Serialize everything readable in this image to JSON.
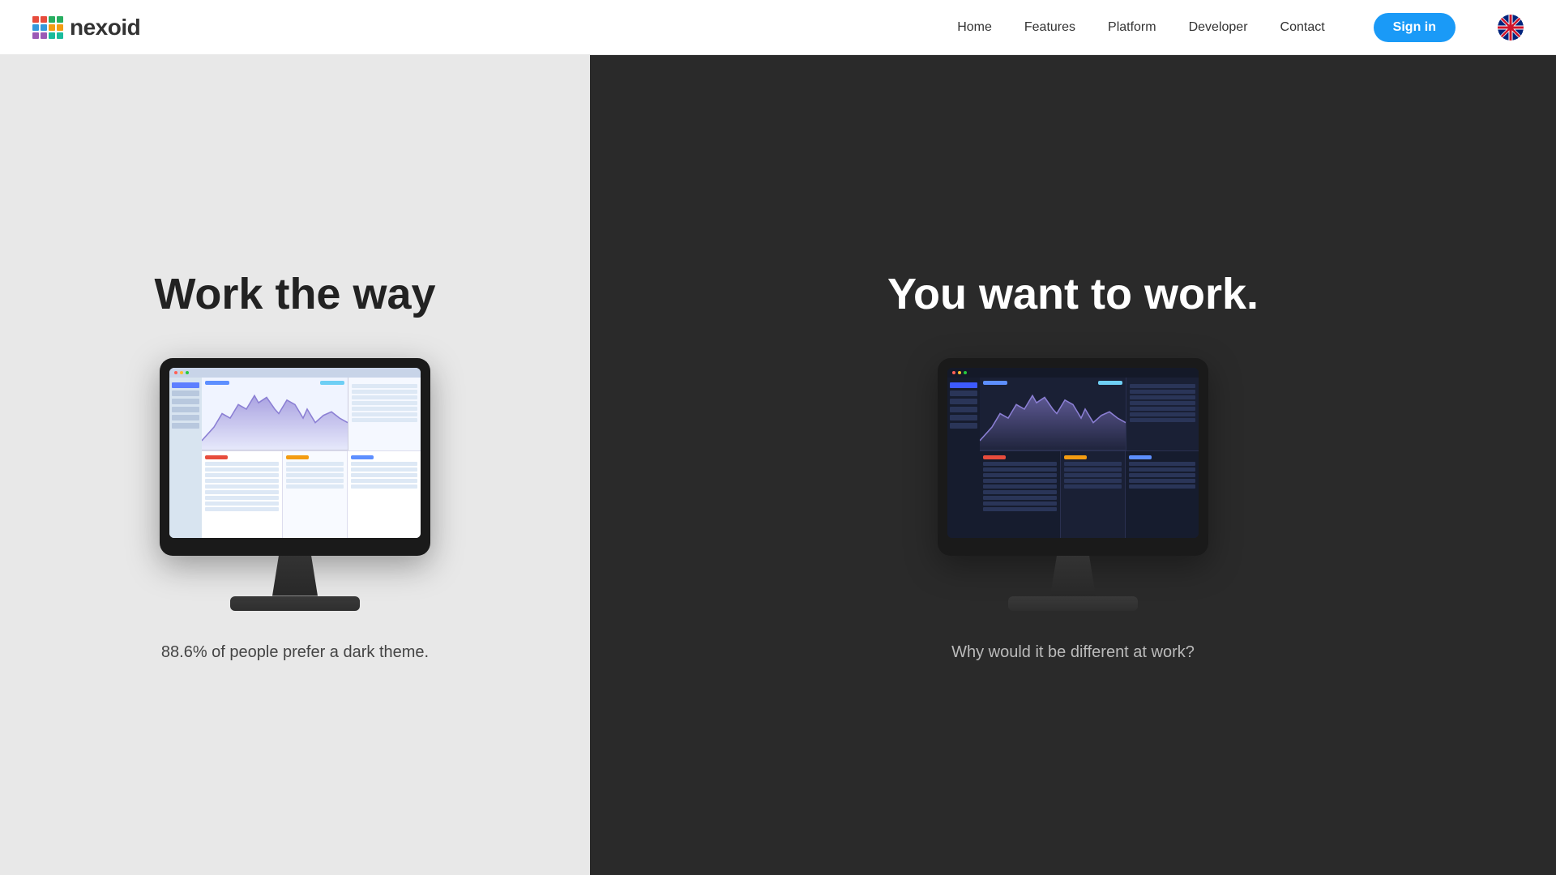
{
  "nav": {
    "brand": "nexoid",
    "links": [
      "Home",
      "Features",
      "Platform",
      "Developer",
      "Contact"
    ],
    "signin_label": "Sign in"
  },
  "left": {
    "heading": "Work the way",
    "subtext": "88.6% of people prefer a dark theme."
  },
  "right": {
    "heading": "You want to work.",
    "subtext": "Why would it be different at work?"
  }
}
